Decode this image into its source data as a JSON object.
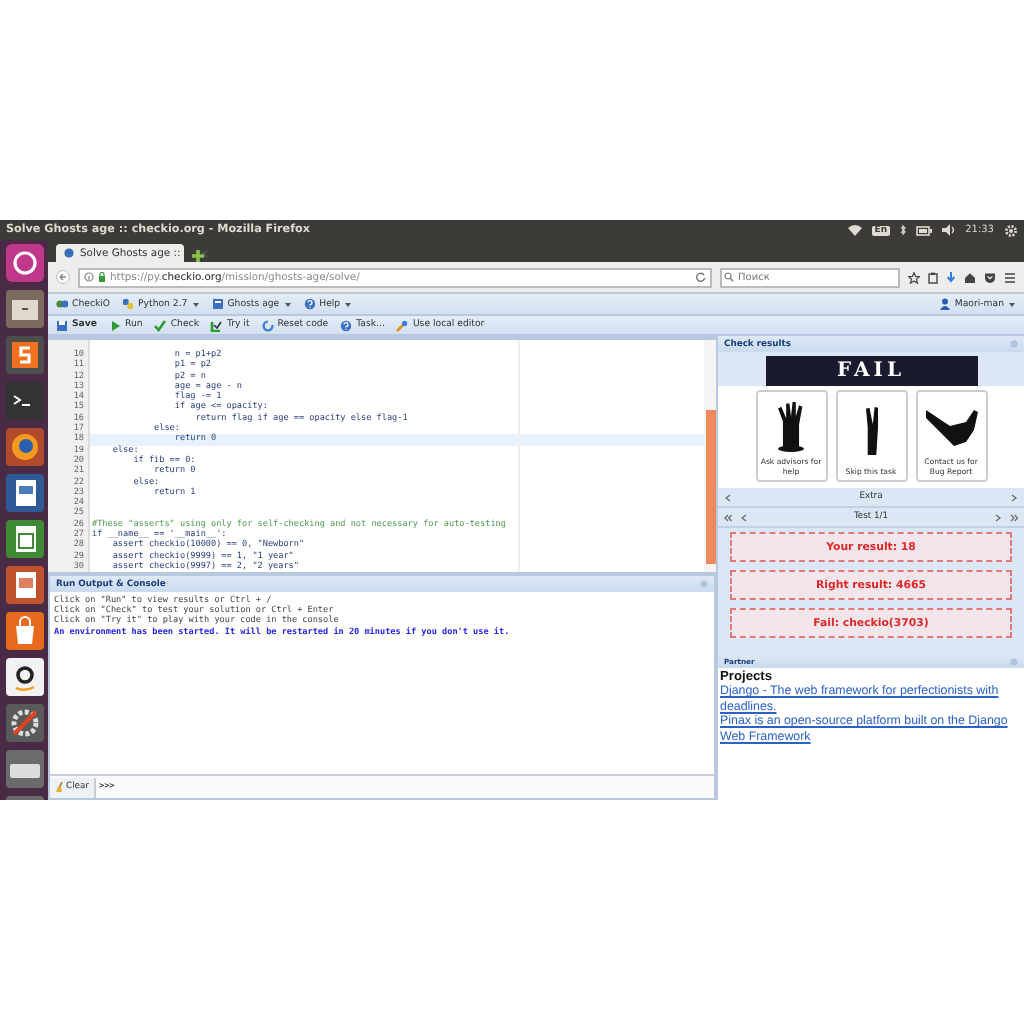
{
  "top_bar": {
    "title": "Solve Ghosts age :: checkio.org - Mozilla Firefox",
    "keyboard_layout": "En",
    "clock": "21:33"
  },
  "browser": {
    "tab": {
      "title": "Solve Ghosts age :: ..."
    },
    "url": "https://py.**checkio.org**/mission/ghosts-age/solve/",
    "search": {
      "placeholder": "Поиск"
    }
  },
  "site_menu": {
    "items": [
      {
        "label": "CheckiO",
        "kind": "logo",
        "caret": false
      },
      {
        "label": "Python 2.7",
        "kind": "python",
        "caret": true
      },
      {
        "label": "Ghosts age",
        "kind": "task",
        "caret": true
      },
      {
        "label": "Help",
        "kind": "help",
        "caret": true
      }
    ],
    "user": {
      "label": "Maori-man",
      "caret": true
    }
  },
  "toolbar": [
    {
      "label": "Save",
      "kind": "save"
    },
    {
      "label": "Run",
      "kind": "run"
    },
    {
      "label": "Check",
      "kind": "check"
    },
    {
      "label": "Try it",
      "kind": "try"
    },
    {
      "label": "Reset code",
      "kind": "reset"
    },
    {
      "label": "Task...",
      "kind": "task"
    },
    {
      "label": "Use local editor",
      "kind": "local"
    }
  ],
  "editor": {
    "lines": [
      {
        "number": "10",
        "text": "                n = p1+p2",
        "kind": "code",
        "current": false
      },
      {
        "number": "11",
        "text": "                p1 = p2",
        "kind": "code",
        "current": false
      },
      {
        "number": "12",
        "text": "                p2 = n",
        "kind": "code",
        "current": false
      },
      {
        "number": "13",
        "text": "                age = age - n",
        "kind": "code",
        "current": false
      },
      {
        "number": "14",
        "text": "                flag -= 1",
        "kind": "code",
        "current": false
      },
      {
        "number": "15",
        "text": "                if age <= opacity:",
        "kind": "code",
        "current": false
      },
      {
        "number": "16",
        "text": "                    return flag if age == opacity else flag-1",
        "kind": "code",
        "current": false
      },
      {
        "number": "17",
        "text": "            else:",
        "kind": "code",
        "current": false
      },
      {
        "number": "18",
        "text": "                return 0",
        "kind": "code",
        "current": true
      },
      {
        "number": "19",
        "text": "    else:",
        "kind": "code",
        "current": false
      },
      {
        "number": "20",
        "text": "        if fib == 0:",
        "kind": "code",
        "current": false
      },
      {
        "number": "21",
        "text": "            return 0",
        "kind": "code",
        "current": false
      },
      {
        "number": "22",
        "text": "        else:",
        "kind": "code",
        "current": false
      },
      {
        "number": "23",
        "text": "            return 1",
        "kind": "code",
        "current": false
      },
      {
        "number": "24",
        "kind": "code",
        "current": false
      },
      {
        "number": "25",
        "kind": "code",
        "current": false
      },
      {
        "number": "26",
        "text": "#These \"asserts\" using only for self-checking and not necessary for auto-testing",
        "kind": "comment",
        "current": false
      },
      {
        "number": "27",
        "text": "if __name__ == '__main__':",
        "kind": "code",
        "current": false
      },
      {
        "number": "28",
        "text": "    assert checkio(10000) == 0, \"Newborn\"",
        "kind": "code",
        "current": false
      },
      {
        "number": "29",
        "text": "    assert checkio(9999) == 1, \"1 year\"",
        "kind": "code",
        "current": false
      },
      {
        "number": "30",
        "text": "    assert checkio(9997) == 2, \"2 years\"",
        "kind": "code",
        "current": false
      }
    ]
  },
  "console": {
    "title": "Run Output & Console",
    "lines": [
      {
        "text": "Click on \"Run\" to view results or Ctrl + /",
        "kind": "info"
      },
      {
        "text": "Click on \"Check\" to test your solution or Ctrl + Enter",
        "kind": "info"
      },
      {
        "text": "Click on \"Try it\" to play with your code in the console",
        "kind": "info"
      },
      {
        "text": "An environment has been started. It will be restarted in 20 minutes if you don't use it.",
        "kind": "notice"
      }
    ],
    "clear_button": "Clear",
    "prompt": ">>>"
  },
  "results": {
    "title": "Check results",
    "banner": "FAIL",
    "help_cards": [
      {
        "label": "Ask advisors for help"
      },
      {
        "label": "Skip this task"
      },
      {
        "label": "Contact us for Bug Report"
      }
    ],
    "extra": "Extra",
    "test_nav": "Test 1/1",
    "outcomes": [
      "Your result: 18",
      "Right result: 4665",
      "Fail: checkio(3703)"
    ]
  },
  "partner": {
    "title": "Partner",
    "heading": "Projects",
    "links": [
      "Django - The web framework for perfectionists with deadlines.",
      "Pinax is an open-source platform built on the Django Web Framework"
    ]
  }
}
